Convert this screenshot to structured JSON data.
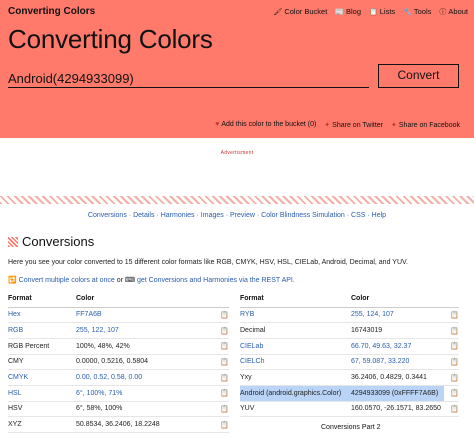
{
  "brand": "Converting Colors",
  "nav": [
    {
      "icon": "🖌",
      "label": "Color Bucket"
    },
    {
      "icon": "📰",
      "label": "Blog"
    },
    {
      "icon": "📋",
      "label": "Lists"
    },
    {
      "icon": "🔧",
      "label": "Tools"
    },
    {
      "icon": "ⓘ",
      "label": "About"
    }
  ],
  "hero": {
    "title": "Converting Colors",
    "input_value": "Android(4294933099)",
    "convert_label": "Convert",
    "actions": [
      {
        "icon": "♥",
        "label": "Add this color to the bucket (0)"
      },
      {
        "icon": "✦",
        "label": "Share on Twitter"
      },
      {
        "icon": "✦",
        "label": "Share on Facebook"
      }
    ]
  },
  "ad_label": "Advertisment",
  "subnav": [
    "Conversions",
    "Details",
    "Harmonies",
    "Images",
    "Preview",
    "Color Blindness Simulation",
    "CSS",
    "Help"
  ],
  "conversions": {
    "title": "Conversions",
    "intro": "Here you see your color converted to 15 different color formats like RGB, CMYK, HSV, HSL, CIELab, Android, Decimal, and YUV.",
    "link1": "Convert multiple colors at once",
    "or": "or",
    "link2": "get Conversions and Harmonies via the REST API.",
    "left": {
      "headers": [
        "Format",
        "Color"
      ],
      "rows": [
        {
          "format": "Hex",
          "value": "FF7A6B",
          "link": true
        },
        {
          "format": "RGB",
          "value": "255, 122, 107",
          "link": true
        },
        {
          "format": "RGB Percent",
          "value": "100%, 48%, 42%",
          "link": false
        },
        {
          "format": "CMY",
          "value": "0.0000, 0.5216, 0.5804",
          "link": false
        },
        {
          "format": "CMYK",
          "value": "0.00, 0.52, 0.58, 0.00",
          "link": true
        },
        {
          "format": "HSL",
          "value": "6°, 100%, 71%",
          "link": true
        },
        {
          "format": "HSV",
          "value": "6°, 58%, 100%",
          "link": false
        },
        {
          "format": "XYZ",
          "value": "50.8534, 36.2406, 18.2248",
          "link": false
        }
      ]
    },
    "right": {
      "headers": [
        "Format",
        "Color"
      ],
      "rows": [
        {
          "format": "RYB",
          "value": "255, 124, 107",
          "link": true
        },
        {
          "format": "Decimal",
          "value": "16743019",
          "link": false
        },
        {
          "format": "CIELab",
          "value": "66.70, 49.63, 32.37",
          "link": true
        },
        {
          "format": "CIELCh",
          "value": "67, 59.087, 33.220",
          "link": true
        },
        {
          "format": "Yxy",
          "value": "36.2406, 0.4829, 0.3441",
          "link": false
        },
        {
          "format": "Android (android.graphics.Color)",
          "value": "4294933099 (0xFFFF7A6B)",
          "link": false,
          "selected": true
        },
        {
          "format": "YUV",
          "value": "160.0570, -26.1571, 83.2650",
          "link": false
        }
      ]
    },
    "copy_icon": "📋",
    "pagination": "Conversions Part 2"
  }
}
